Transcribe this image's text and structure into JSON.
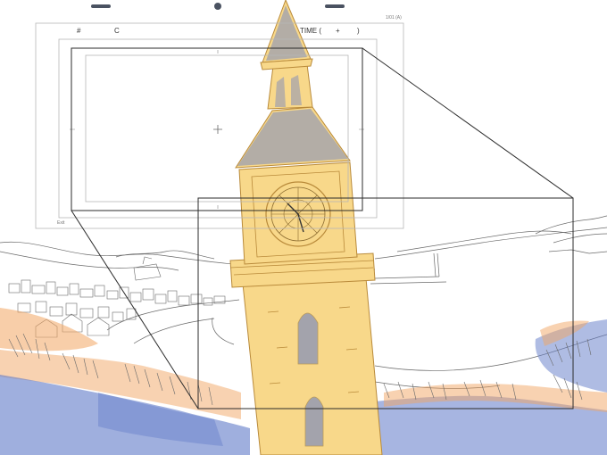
{
  "sheet": {
    "field_label": "#",
    "cut_label": "C",
    "time_label": "TIME (",
    "time_plus": "+",
    "time_close": ")",
    "page_no": "1/01 (A)",
    "corner_mark": "Exit"
  },
  "colors": {
    "tower_fill": "#f8d88a",
    "tower_line": "#b98a3a",
    "shade_blue": "#5f79c8",
    "shade_orange": "#f2a563",
    "pencil": "#6a6a6a",
    "frame": "#2b2b2b",
    "frame_light": "#b7b7b7",
    "knob": "#4a5261"
  },
  "icons": {
    "top_handles": "pill-and-dot-handles",
    "center_cross": "crosshair-icon"
  }
}
